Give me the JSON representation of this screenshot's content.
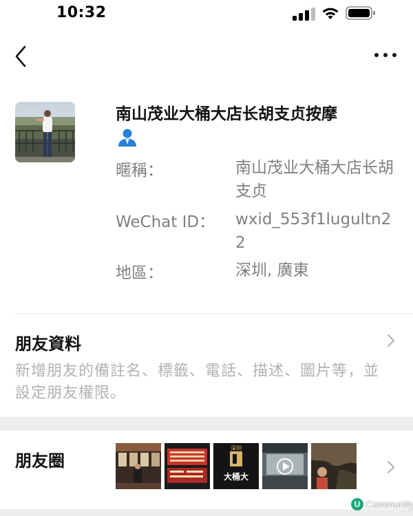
{
  "status_bar": {
    "time": "10:32"
  },
  "profile": {
    "name": "南山茂业大桶大店长胡支贞按摩",
    "nickname_label": "暱稱：",
    "nickname_value": "南山茂业大桶大店长胡支贞",
    "wechat_id_label": "WeChat ID：",
    "wechat_id_value": "wxid_553f1lugultn22",
    "region_label": "地區：",
    "region_value": "深圳, 廣東"
  },
  "friend_info": {
    "title": "朋友資料",
    "description": "新增朋友的備註名、標籤、電話、描述、圖片等，並設定朋友權限。"
  },
  "moments": {
    "title": "朋友圈",
    "thumbnails": [
      "thumb-1",
      "thumb-2",
      "thumb-3",
      "thumb-4",
      "thumb-5"
    ],
    "thumb3_lines": [
      "深圳",
      "大桶大"
    ]
  },
  "watermark": {
    "letter": "U",
    "text": "Community"
  },
  "colors": {
    "gender_icon": "#2782d7",
    "label_gray": "#7f7f7f",
    "desc_gray": "#b2b2b2",
    "section_gap": "#ededed"
  }
}
